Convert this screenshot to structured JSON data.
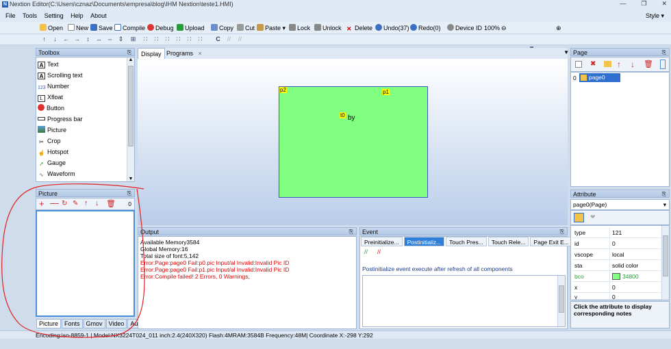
{
  "window": {
    "title": "Nextion Editor(C:\\Users\\cznaz\\Documents\\empresa\\blog\\IHM Nextion\\teste1.HMI)",
    "logo": "N"
  },
  "menu": {
    "items": [
      "File",
      "Tools",
      "Setting",
      "Help",
      "About"
    ],
    "style": "Style"
  },
  "toolbar": {
    "open": "Open",
    "new": "New",
    "save": "Save",
    "compile": "Compile",
    "debug": "Debug",
    "upload": "Upload",
    "copy": "Copy",
    "cut": "Cut",
    "paste": "Paste",
    "lock": "Lock",
    "unlock": "Unlock",
    "delete": "Delete",
    "undo": "Undo(37)",
    "redo": "Redo(0)",
    "device_id": "Device ID",
    "zoom": "100%"
  },
  "toolbox": {
    "title": "Toolbox",
    "items": [
      {
        "label": "Text",
        "icon": "text-icon"
      },
      {
        "label": "Scrolling text",
        "icon": "scrolling-text-icon"
      },
      {
        "label": "Number",
        "icon": "number-icon"
      },
      {
        "label": "Xfloat",
        "icon": "xfloat-icon"
      },
      {
        "label": "Button",
        "icon": "button-icon"
      },
      {
        "label": "Progress bar",
        "icon": "progress-bar-icon"
      },
      {
        "label": "Picture",
        "icon": "picture-icon"
      },
      {
        "label": "Crop",
        "icon": "crop-icon"
      },
      {
        "label": "Hotspot",
        "icon": "hotspot-icon"
      },
      {
        "label": "Gauge",
        "icon": "gauge-icon"
      },
      {
        "label": "Waveform",
        "icon": "waveform-icon"
      }
    ]
  },
  "picture_panel": {
    "title": "Picture",
    "count": "0",
    "tabs": [
      "Picture",
      "Fonts",
      "Gmov",
      "Video",
      "Audio"
    ]
  },
  "display": {
    "tabs": [
      "Display",
      "Programs"
    ],
    "close_glyph": "×",
    "components": {
      "p2": "p2",
      "p1": "p1",
      "t0": "t0",
      "by": "by"
    }
  },
  "output": {
    "title": "Output",
    "lines": [
      "Available Memory3584",
      "Global Memory:16",
      "Total size of font:5,142",
      "Error:Page:page0 Fail:p0.pic Input/al Invalid:Invalid Pic ID",
      "Error:Page:page0 Fail:p1.pic Input/al Invalid:Invalid Pic ID",
      "Error:Compile failed! 2 Errors, 0 Warnings,"
    ],
    "error_color": "#e00000"
  },
  "event": {
    "title": "Event",
    "tabs": [
      "Preinitialize...",
      "Postinitializ...",
      "Touch Pres...",
      "Touch Rele...",
      "Page Exit E..."
    ],
    "description": "Postinitialize event execute after refresh of all components"
  },
  "page_panel": {
    "title": "Page",
    "rows": [
      {
        "index": "0",
        "name": "page0"
      }
    ]
  },
  "attribute": {
    "title": "Attribute",
    "selector": "page0(Page)",
    "rows": [
      {
        "k": "type",
        "v": "121"
      },
      {
        "k": "id",
        "v": "0"
      },
      {
        "k": "vscope",
        "v": "local"
      },
      {
        "k": "sta",
        "v": "solid color"
      },
      {
        "k": "bco",
        "v": "34800"
      },
      {
        "k": "x",
        "v": "0"
      },
      {
        "k": "y",
        "v": "0"
      }
    ],
    "bco_color": "#80ff80",
    "note": "Click the attribute to display corresponding notes"
  },
  "statusbar": {
    "text": "Encoding:iso-8859-1 | Model:NX3224T024_011 inch:2.4(240X320) Flash:4MRAM:3584B Frequency:48M|  Coordinate X:-298  Y:292"
  },
  "colors": {
    "accent": "#2f7fd8",
    "screen_bg": "#80ff80",
    "annotation": "#e02020"
  }
}
